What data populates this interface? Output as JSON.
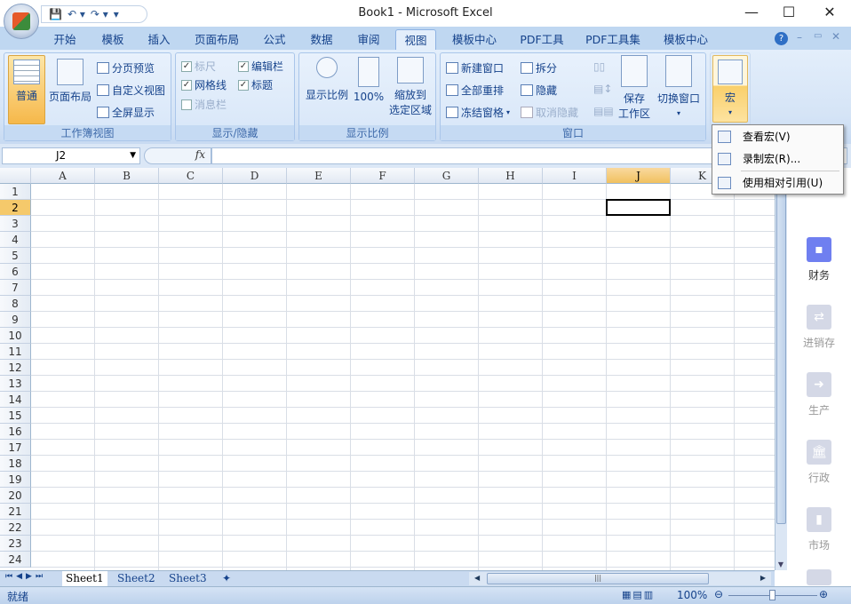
{
  "window": {
    "title": "Book1 - Microsoft Excel"
  },
  "qat": {
    "save": "💾",
    "undo": "↶ ▾",
    "redo": "↷ ▾",
    "custom": "▾"
  },
  "tabs": [
    "开始",
    "模板",
    "插入",
    "页面布局",
    "公式",
    "数据",
    "审阅",
    "视图",
    "模板中心",
    "PDF工具",
    "PDF工具集",
    "模板中心"
  ],
  "active_tab": "视图",
  "ribbon": {
    "workbook_views": {
      "label": "工作簿视图",
      "normal": "普通",
      "page_layout": "页面布局",
      "page_break": "分页预览",
      "custom_views": "自定义视图",
      "full_screen": "全屏显示"
    },
    "show_hide": {
      "label": "显示/隐藏",
      "ruler": "标尺",
      "gridlines": "网格线",
      "message_bar": "消息栏",
      "formula_bar": "编辑栏",
      "headings": "标题",
      "ruler_checked": true,
      "gridlines_checked": true,
      "message_bar_checked": false,
      "formula_bar_checked": true,
      "headings_checked": true
    },
    "zoom": {
      "label": "显示比例",
      "zoom": "显示比例",
      "hundred": "100%",
      "zoom_sel_1": "缩放到",
      "zoom_sel_2": "选定区域"
    },
    "window": {
      "label": "窗口",
      "new_window": "新建窗口",
      "arrange_all": "全部重排",
      "freeze": "冻结窗格",
      "split": "拆分",
      "hide": "隐藏",
      "unhide": "取消隐藏",
      "save_ws_1": "保存",
      "save_ws_2": "工作区",
      "switch": "切换窗口"
    },
    "macros": {
      "label": "宏"
    }
  },
  "macro_menu": [
    "查看宏(V)",
    "录制宏(R)...",
    "使用相对引用(U)"
  ],
  "formula_bar": {
    "name_box": "J2",
    "fx": "fx",
    "value": ""
  },
  "columns": [
    "A",
    "B",
    "C",
    "D",
    "E",
    "F",
    "G",
    "H",
    "I",
    "J",
    "K"
  ],
  "rows": [
    "1",
    "2",
    "3",
    "4",
    "5",
    "6",
    "7",
    "8",
    "9",
    "10",
    "11",
    "12",
    "13",
    "14",
    "15",
    "16",
    "17",
    "18",
    "19",
    "20",
    "21",
    "22",
    "23",
    "24"
  ],
  "selected_cell": "J2",
  "side_panel": [
    "财务",
    "进销存",
    "生产",
    "行政",
    "市场"
  ],
  "sheets": [
    "Sheet1",
    "Sheet2",
    "Sheet3"
  ],
  "active_sheet": "Sheet1",
  "status": {
    "ready": "就绪",
    "zoom": "100%"
  }
}
